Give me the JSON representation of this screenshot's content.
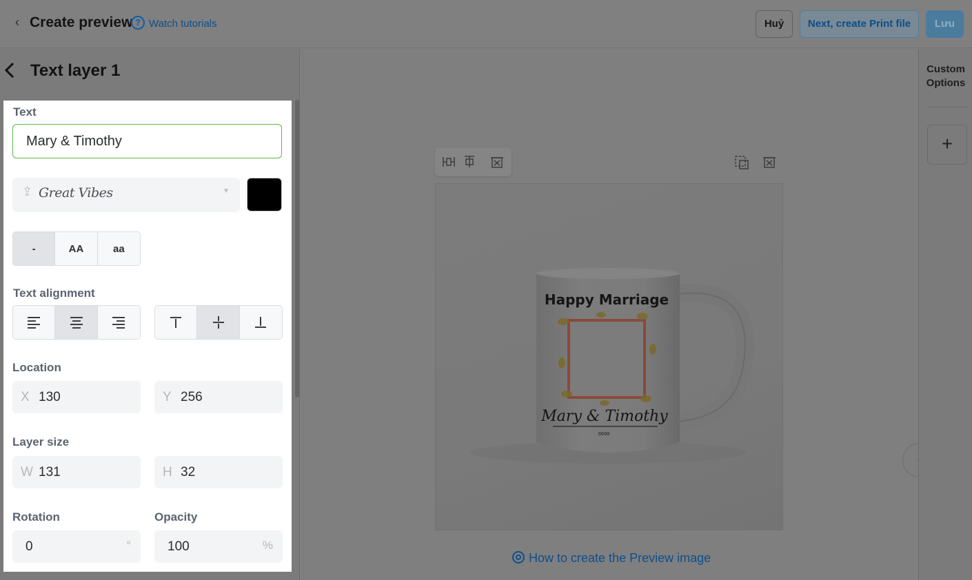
{
  "header": {
    "title": "Create preview",
    "tutorials_link": "Watch tutorials",
    "cancel_label": "Huỷ",
    "next_label": "Next, create Print file",
    "save_label": "Lưu"
  },
  "layer": {
    "title": "Text layer 1"
  },
  "form": {
    "text_label": "Text",
    "text_value": "Mary & Timothy",
    "font_name": "Great Vibes",
    "text_color": "#000000",
    "case_options": [
      "-",
      "AA",
      "aa"
    ],
    "case_selected": "-",
    "alignment_label": "Text alignment",
    "h_align_selected": "center",
    "v_align_selected": "middle",
    "location_label": "Location",
    "x_prefix": "X",
    "x_value": "130",
    "y_prefix": "Y",
    "y_value": "256",
    "size_label": "Layer size",
    "w_prefix": "W",
    "w_value": "131",
    "h_prefix": "H",
    "h_value": "32",
    "rotation_label": "Rotation",
    "rotation_value": "0",
    "rotation_unit": "°",
    "opacity_label": "Opacity",
    "opacity_value": "100",
    "opacity_unit": "%"
  },
  "canvas": {
    "mug_heading": "Happy Marriage",
    "mug_names": "Mary & Timothy",
    "how_to_link": "How to create the Preview image"
  },
  "right_rail": {
    "custom_options_line1": "Custom",
    "custom_options_line2": "Options",
    "add_label": "+"
  },
  "colors": {
    "accent_green": "#5bb547",
    "link_blue": "#0f4f8c",
    "overlay_gray": "#808080"
  }
}
